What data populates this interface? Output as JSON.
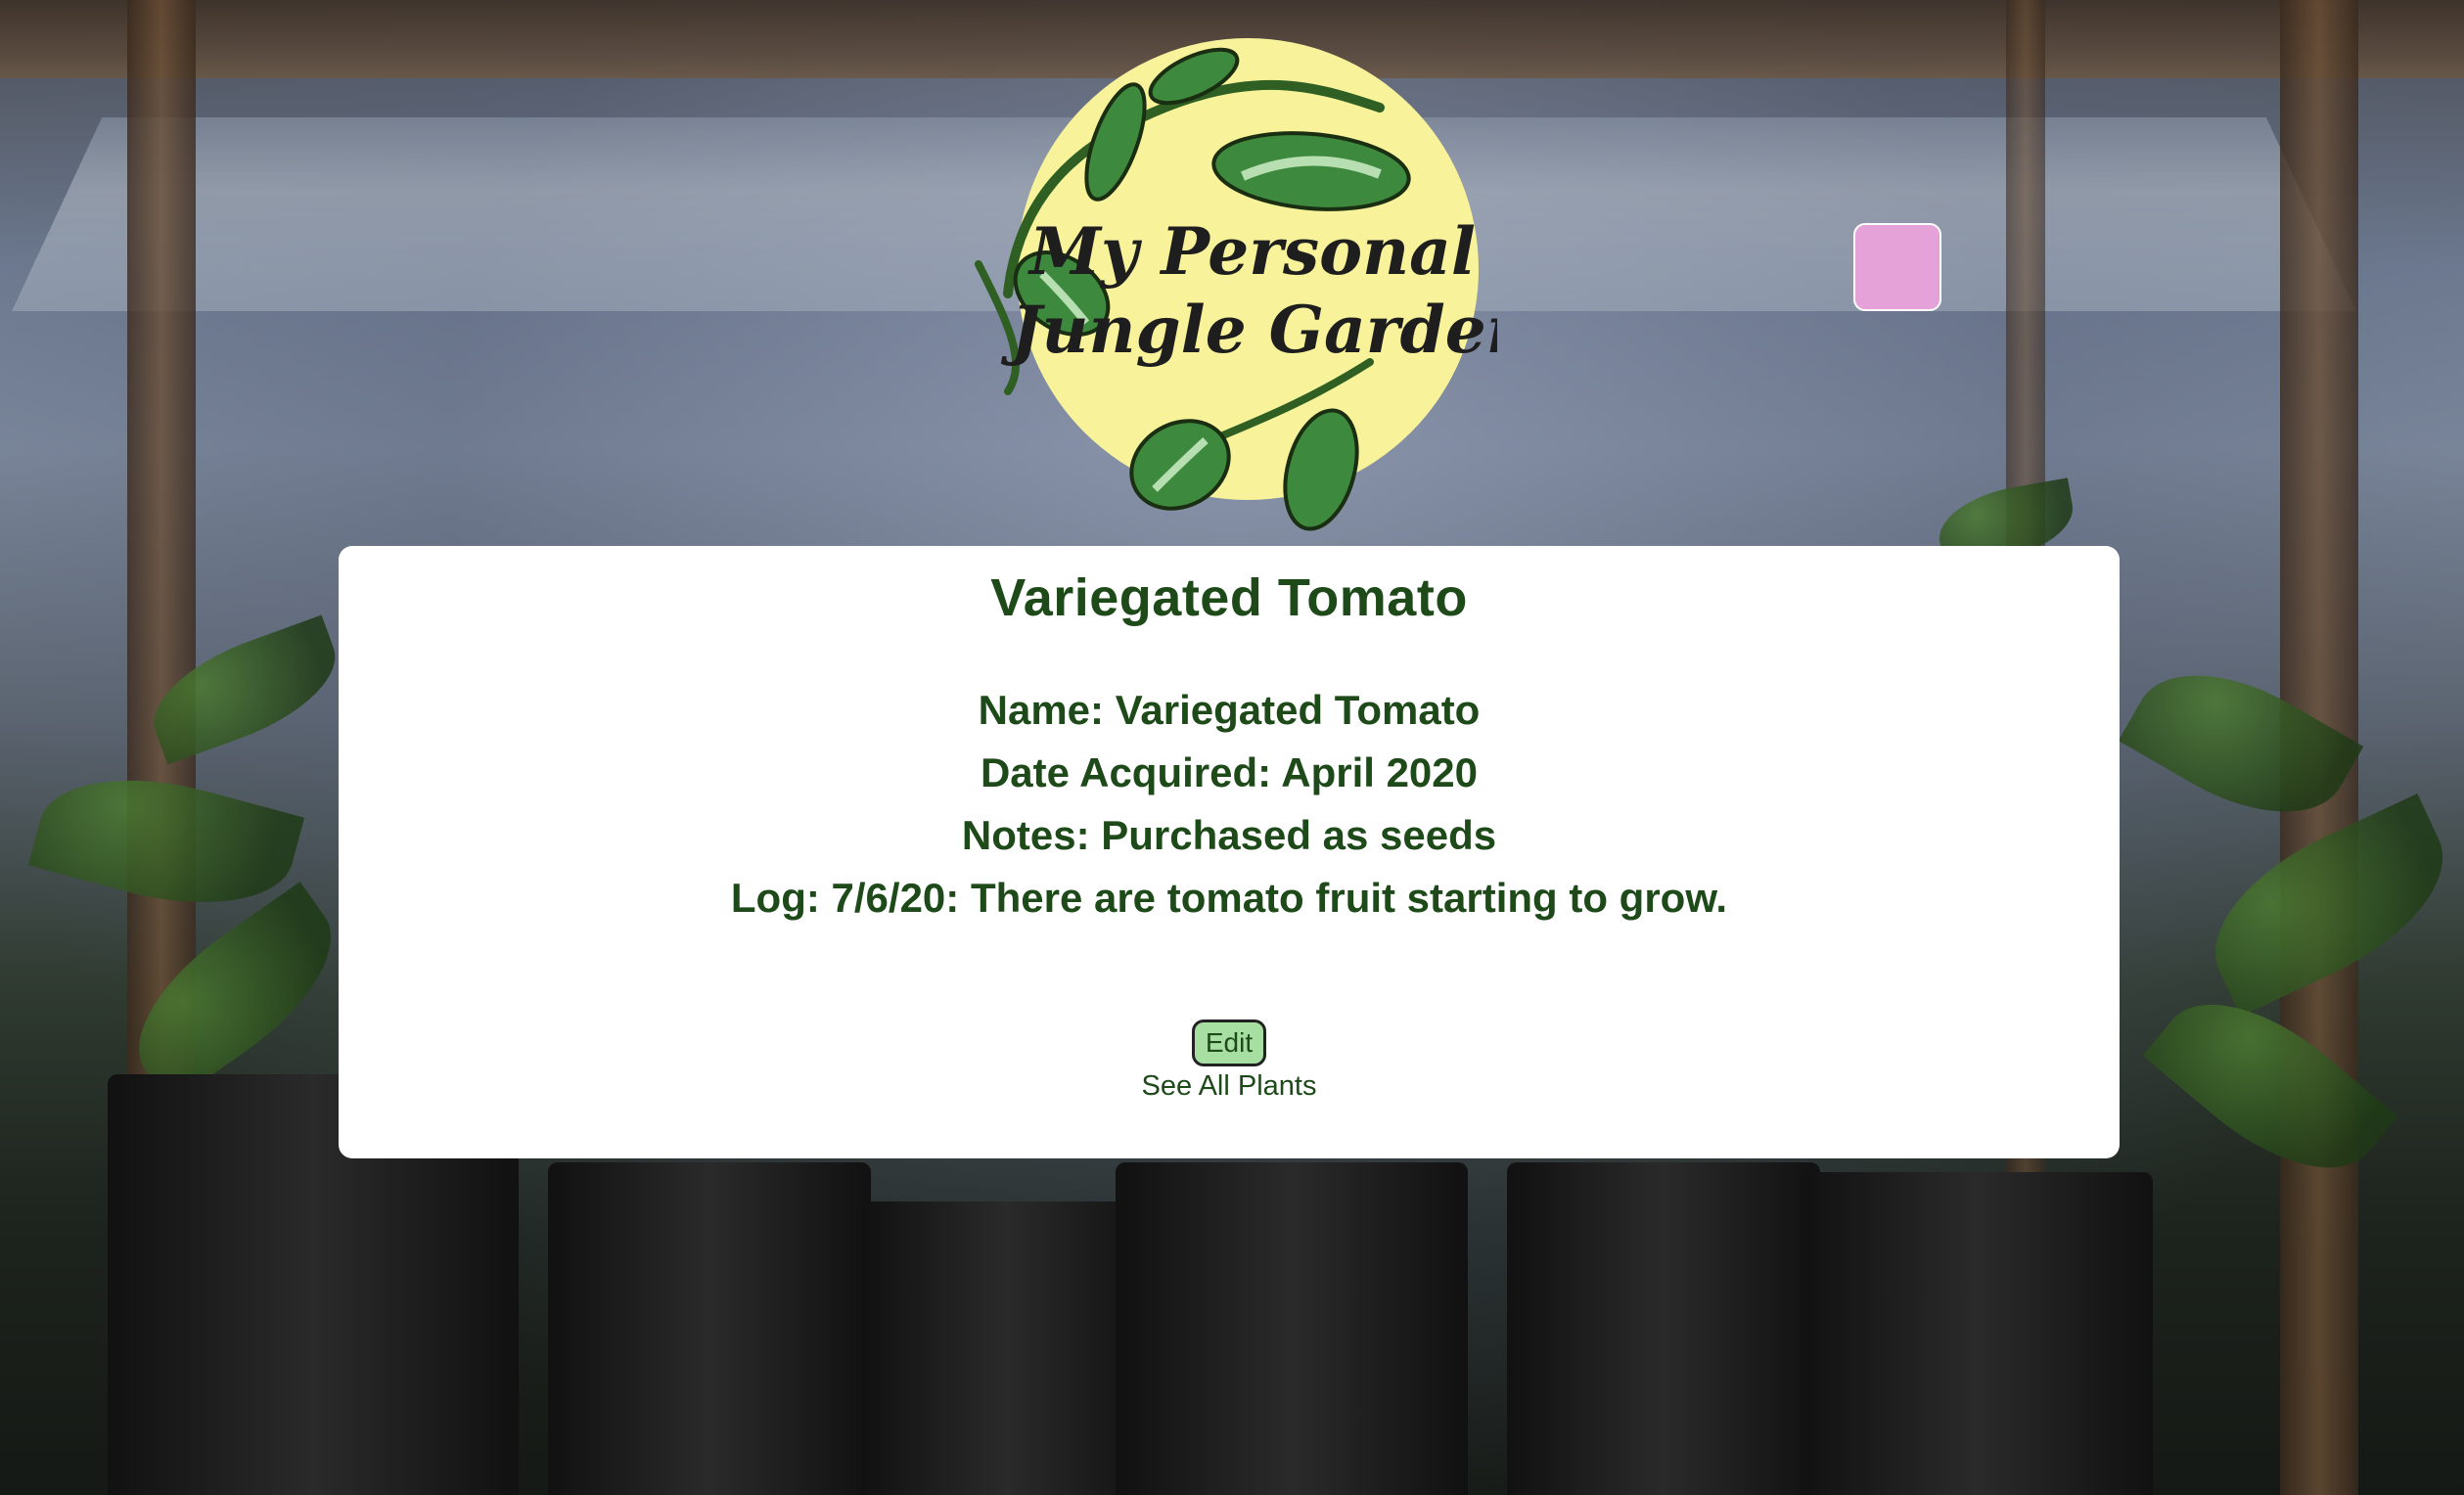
{
  "logo": {
    "line1": "My Personal",
    "line2": "Jungle Garden",
    "circle_color": "#f8f29a"
  },
  "plant": {
    "title": "Variegated Tomato",
    "name": "Name: Variegated Tomato",
    "date": "Date Acquired: April 2020",
    "notes": "Notes: Purchased as seeds",
    "log": "Log: 7/6/20: There are tomato fruit starting to grow."
  },
  "actions": {
    "edit_label": "Edit",
    "see_all_label": "See All Plants"
  },
  "colors": {
    "text": "#1e4a1a",
    "edit_button": "#a7dfa3",
    "menu_square": "#e4a2d9"
  }
}
